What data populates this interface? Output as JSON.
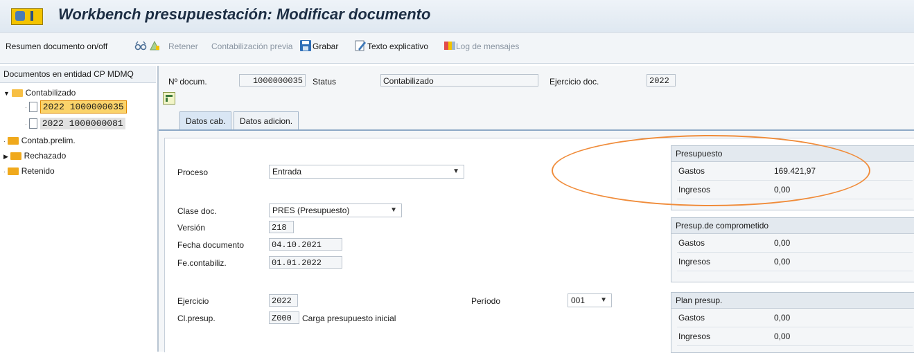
{
  "window": {
    "title": "Workbench presupuestación: Modificar documento"
  },
  "toolbar": {
    "summary": "Resumen documento on/off",
    "hold": "Retener",
    "simulate": "Contabilización previa",
    "save": "Grabar",
    "text": "Texto explicativo",
    "log": "Log de mensajes"
  },
  "tree": {
    "header": "Documentos en entidad CP MDMQ",
    "posted": "Contabilizado",
    "doc1": "2022 1000000035",
    "doc2": "2022 1000000081",
    "parked": "Contab.prelim.",
    "rejected": "Rechazado",
    "held": "Retenido"
  },
  "header": {
    "docnum_label": "Nº docum.",
    "docnum_value": "1000000035",
    "status_label": "Status",
    "status_value": "Contabilizado",
    "year_label": "Ejercicio doc.",
    "year_value": "2022"
  },
  "tabs": {
    "tab1": "Datos cab.",
    "tab2": "Datos adicion."
  },
  "form": {
    "process_label": "Proceso",
    "process_value": "Entrada",
    "doctype_label": "Clase doc.",
    "doctype_value": "PRES (Presupuesto)",
    "version_label": "Versión",
    "version_value": "218",
    "docdate_label": "Fecha documento",
    "docdate_value": "04.10.2021",
    "postdate_label": "Fe.contabiliz.",
    "postdate_value": "01.01.2022",
    "fy_label": "Ejercicio",
    "fy_value": "2022",
    "period_label": "Período",
    "period_value": "001",
    "budcat_label": "Cl.presup.",
    "budcat_value": "Z000",
    "budcat_text": "Carga presupuesto inicial"
  },
  "groups": {
    "budget": {
      "title": "Presupuesto",
      "expenses_label": "Gastos",
      "expenses_value": "169.421,97",
      "revenues_label": "Ingresos",
      "revenues_value": "0,00"
    },
    "commitment": {
      "title": "Presup.de comprometido",
      "expenses_label": "Gastos",
      "expenses_value": "0,00",
      "revenues_label": "Ingresos",
      "revenues_value": "0,00"
    },
    "plan": {
      "title": "Plan presup.",
      "expenses_label": "Gastos",
      "expenses_value": "0,00",
      "revenues_label": "Ingresos",
      "revenues_value": "0,00"
    }
  },
  "colors": {
    "highlight_ellipse": "#f08c3a",
    "selected_doc": "#fbd36a"
  }
}
